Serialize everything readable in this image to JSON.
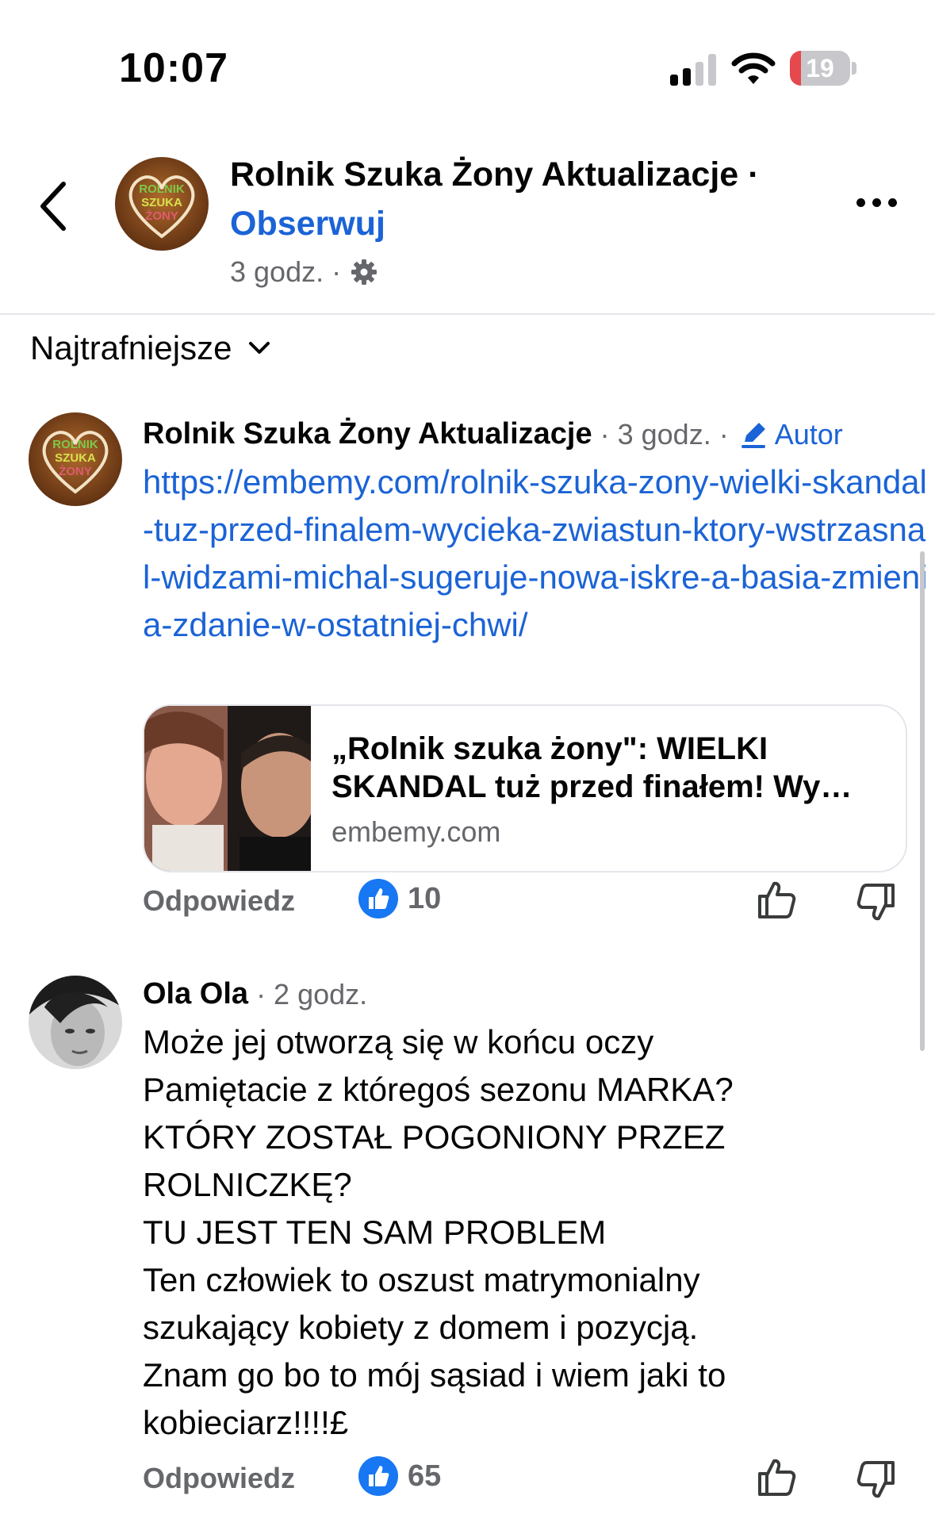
{
  "status_bar": {
    "time": "10:07",
    "battery": "19",
    "battery_level": 0.19
  },
  "header": {
    "title": "Rolnik Szuka Żony Aktualizacje ·",
    "follow": "Obserwuj",
    "time": "3 godz. ·",
    "avatar_lines": [
      "ROLNIK",
      "SZUKA",
      "ŻONY"
    ]
  },
  "sort": {
    "label": "Najtrafniejsze"
  },
  "comments": [
    {
      "author": "Rolnik Szuka Żony Aktualizacje",
      "meta": "· 3 godz. ·",
      "badge": "Autor",
      "link": "https://embemy.com/rolnik-szuka-zony-wielki-skandal-tuz-przed-finalem-wycieka-zwiastun-ktory-wstrzasnal-widzami-michal-sugeruje-nowa-iskre-a-basia-zmienia-zdanie-w-ostatniej-chwi/",
      "card": {
        "title_line1": "„Rolnik szuka żony\": WIELKI",
        "title_line2": "SKANDAL tuż przed finałem! Wy…",
        "domain": "embemy.com"
      },
      "reply": "Odpowiedz",
      "likes": "10"
    },
    {
      "author": "Ola Ola",
      "meta": "· 2 godz.",
      "text": "Może jej otworzą się w końcu oczy\nPamiętacie z któregoś sezonu MARKA?\nKTÓRY ZOSTAŁ POGONIONY PRZEZ\nROLNICZKĘ?\nTU JEST TEN SAM PROBLEM\nTen człowiek to oszust matrymonialny\nszukający kobiety z domem i pozycją.\nZnam go bo to mój sąsiad i wiem jaki to\nkobieciarz!!!!£",
      "reply": "Odpowiedz",
      "likes": "65"
    }
  ],
  "colors": {
    "accent": "#1b63d6",
    "secondary_text": "#65676b",
    "battery_fill": "#e5484d"
  }
}
